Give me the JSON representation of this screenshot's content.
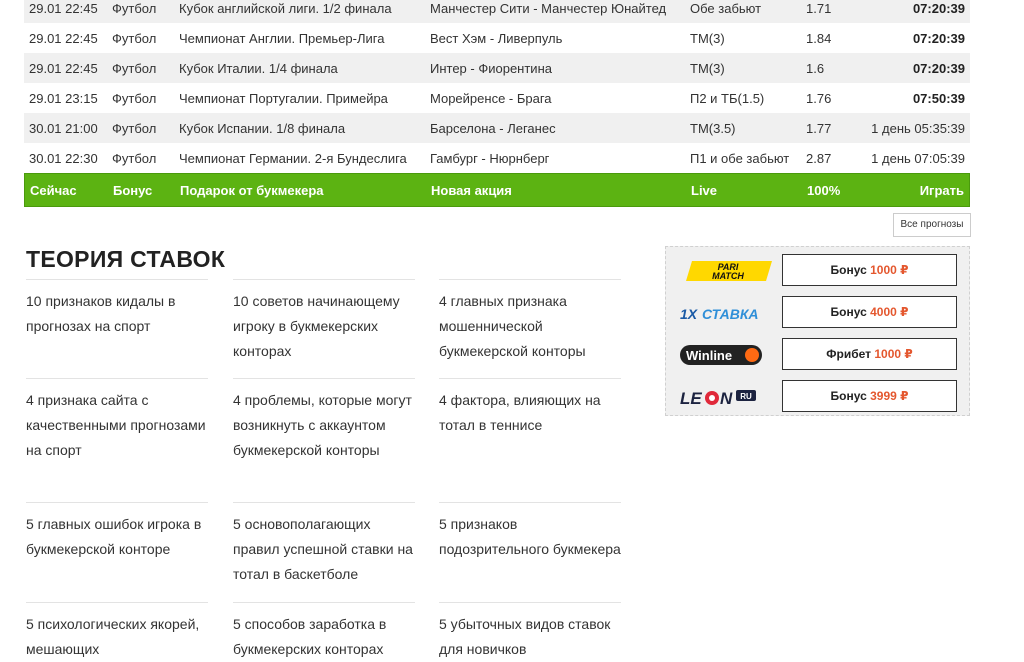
{
  "matches": [
    {
      "date": "29.01 22:45",
      "sport": "Футбол",
      "tournament": "Кубок английской лиги. 1/2 финала",
      "match": "Манчестер Сити - Манчестер Юнайтед",
      "bet": "Обе забьют",
      "odds": "1.71",
      "time_prefix": "",
      "time": "07:20:39",
      "bold": true
    },
    {
      "date": "29.01 22:45",
      "sport": "Футбол",
      "tournament": "Чемпионат Англии. Премьер-Лига",
      "match": "Вест Хэм - Ливерпуль",
      "bet": "ТМ(3)",
      "odds": "1.84",
      "time_prefix": "",
      "time": "07:20:39",
      "bold": true
    },
    {
      "date": "29.01 22:45",
      "sport": "Футбол",
      "tournament": "Кубок Италии. 1/4 финала",
      "match": "Интер - Фиорентина",
      "bet": "ТМ(3)",
      "odds": "1.6",
      "time_prefix": "",
      "time": "07:20:39",
      "bold": true
    },
    {
      "date": "29.01 23:15",
      "sport": "Футбол",
      "tournament": "Чемпионат Португалии. Примейра",
      "match": "Морейренсе - Брага",
      "bet": "П2 и ТБ(1.5)",
      "odds": "1.76",
      "time_prefix": "",
      "time": "07:50:39",
      "bold": true
    },
    {
      "date": "30.01 21:00",
      "sport": "Футбол",
      "tournament": "Кубок Испании. 1/8 финала",
      "match": "Барселона - Леганес",
      "bet": "ТМ(3.5)",
      "odds": "1.77",
      "time_prefix": "1 день",
      "time": "05:35:39",
      "bold": false
    },
    {
      "date": "30.01 22:30",
      "sport": "Футбол",
      "tournament": "Чемпионат Германии. 2-я Бундеслига",
      "match": "Гамбург - Нюрнберг",
      "bet": "П1 и обе забьют",
      "odds": "2.87",
      "time_prefix": "1 день",
      "time": "07:05:39",
      "bold": false
    }
  ],
  "promo": {
    "date": "Сейчас",
    "sport": "Бонус",
    "tournament": "Подарок от букмекера",
    "match": "Новая акция",
    "bet": "Live",
    "odds": "100%",
    "action": "Играть"
  },
  "all_predictions_label": "Все прогнозы",
  "theory": {
    "title": "ТЕОРИЯ СТАВОК",
    "articles": [
      "10 признаков кидалы в прогнозах на спорт",
      "10 советов начинающему игроку в букмекерских конторах",
      "4 главных признака мошеннической букмекерской конторы",
      "4 признака сайта с качественными прогнозами на спорт",
      "4 проблемы, которые могут возникнуть с аккаунтом букмекерской конторы",
      "4 фактора, влияющих на тотал в теннисе",
      "5 главных ошибок игрока в букмекерской конторе",
      "5 основополагающих правил успешной ставки на тотал в баскетболе",
      "5 признаков подозрительного букмекера",
      "5 психологических якорей, мешающих",
      "5 способов заработка в букмекерских конторах",
      "5 убыточных видов ставок для новичков"
    ]
  },
  "bookmakers": [
    {
      "logo": "PARI MATCH",
      "logo_icon": "parimatch-logo",
      "bonus_label": "Бонус",
      "amount": "1000 ₽"
    },
    {
      "logo": "1ХСТАВКА",
      "logo_icon": "1xstavka-logo",
      "bonus_label": "Бонус",
      "amount": "4000 ₽"
    },
    {
      "logo": "Winline",
      "logo_icon": "winline-logo",
      "bonus_label": "Фрибет",
      "amount": "1000 ₽"
    },
    {
      "logo": "LEON",
      "logo_badge": "RU",
      "logo_icon": "leon-logo",
      "bonus_label": "Бонус",
      "amount": "3999 ₽"
    }
  ],
  "colors": {
    "promo_green": "#5cb312",
    "amount_red": "#e4572e",
    "row_alt": "#f0f0f0"
  }
}
